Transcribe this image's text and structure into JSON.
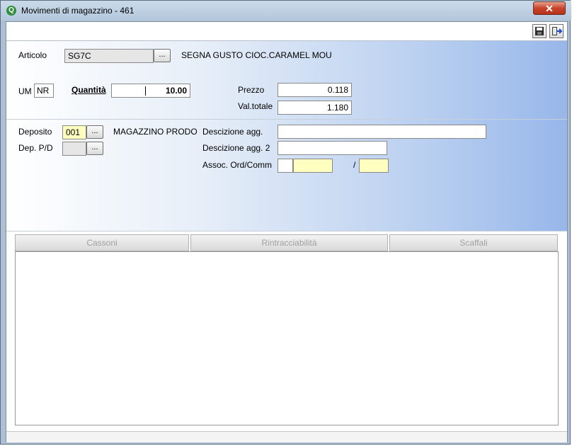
{
  "window": {
    "title": "Movimenti di magazzino - 461",
    "app_icon": "Q",
    "close_label": "✕"
  },
  "toolbar": {
    "save_icon": "save-icon",
    "exit_icon": "exit-door-icon"
  },
  "articolo": {
    "label": "Articolo",
    "code": "SG7C",
    "lookup_label": "...",
    "description": "SEGNA GUSTO CIOC.CARAMEL MOU"
  },
  "um": {
    "label": "UM",
    "value": "NR"
  },
  "quantita": {
    "label": "Quantità",
    "value": "10.00"
  },
  "prezzo": {
    "label": "Prezzo",
    "value": "0.118"
  },
  "valtotale": {
    "label": "Val.totale",
    "value": "1.180"
  },
  "deposito": {
    "label": "Deposito",
    "code": "001",
    "lookup_label": "...",
    "description": "MAGAZZINO PRODOT"
  },
  "dep_pd": {
    "label": "Dep. P/D",
    "code": "",
    "lookup_label": "..."
  },
  "descr_agg": {
    "label": "Descizione agg.",
    "value": ""
  },
  "descr_agg2": {
    "label": "Descizione agg. 2",
    "value": ""
  },
  "assoc": {
    "label": "Assoc. Ord/Comm",
    "field1": "",
    "field2": "",
    "separator": "/",
    "field3": ""
  },
  "tabs": [
    {
      "label": "Cassoni"
    },
    {
      "label": "Rintracciabilità"
    },
    {
      "label": "Scaffali"
    }
  ],
  "colors": {
    "panel_gradient_end": "#97b7ea",
    "required_field": "#ffffc0",
    "disabled_field": "#e6e6e6"
  }
}
